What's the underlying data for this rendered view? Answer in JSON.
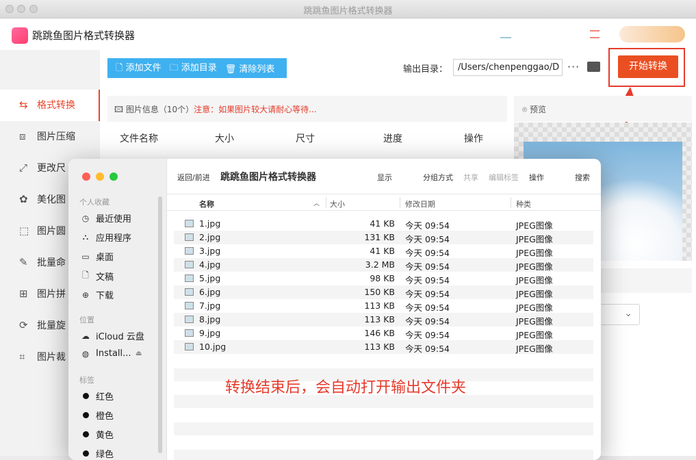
{
  "window": {
    "title": "跳跳鱼图片格式转换器"
  },
  "app": {
    "name": "跳跳鱼图片格式转换器"
  },
  "sidebar": {
    "items": [
      {
        "label": "格式转换",
        "icon": "convert-icon"
      },
      {
        "label": "图片压缩",
        "icon": "compress-icon"
      },
      {
        "label": "更改尺",
        "icon": "resize-icon"
      },
      {
        "label": "美化图",
        "icon": "beautify-icon"
      },
      {
        "label": "图片圆",
        "icon": "round-corner-icon"
      },
      {
        "label": "批量命",
        "icon": "rename-icon"
      },
      {
        "label": "图片拼",
        "icon": "stitch-icon"
      },
      {
        "label": "批量旋",
        "icon": "rotate-icon"
      },
      {
        "label": "图片裁",
        "icon": "crop-icon"
      }
    ]
  },
  "toolbar": {
    "add_file": "添加文件",
    "add_dir": "添加目录",
    "clear_list": "清除列表",
    "output_label": "输出目录：",
    "output_path": "/Users/chenpenggao/D",
    "more": "···",
    "start": "开始转换"
  },
  "info": {
    "title": "图片信息（10个）",
    "warning": "注意：如果图片较大请耐心等待..."
  },
  "table": {
    "headers": [
      "文件名称",
      "大小",
      "尺寸",
      "进度",
      "操作"
    ]
  },
  "preview": {
    "title": "预览"
  },
  "finder": {
    "nav": "返回/前进",
    "title": "跳跳鱼图片格式转换器",
    "toolbar": [
      "显示",
      "分组方式",
      "共享",
      "编辑标签",
      "操作",
      "搜索"
    ],
    "sections": {
      "favorites": "个人收藏",
      "locations": "位置",
      "tags": "标签"
    },
    "favorites": [
      {
        "label": "最近使用",
        "icon": "clock-icon"
      },
      {
        "label": "应用程序",
        "icon": "apps-icon"
      },
      {
        "label": "桌面",
        "icon": "desktop-icon"
      },
      {
        "label": "文稿",
        "icon": "document-icon"
      },
      {
        "label": "下载",
        "icon": "download-icon"
      }
    ],
    "locations": [
      {
        "label": "iCloud 云盘",
        "icon": "cloud-icon"
      },
      {
        "label": "Install...",
        "icon": "disk-icon"
      }
    ],
    "tags": [
      {
        "label": "红色"
      },
      {
        "label": "橙色"
      },
      {
        "label": "黄色"
      },
      {
        "label": "绿色"
      }
    ],
    "columns": [
      "名称",
      "大小",
      "修改日期",
      "种类"
    ],
    "files": [
      {
        "name": "1.jpg",
        "size": "41 KB",
        "date": "今天 09:54",
        "kind": "JPEG图像"
      },
      {
        "name": "2.jpg",
        "size": "131 KB",
        "date": "今天 09:54",
        "kind": "JPEG图像"
      },
      {
        "name": "3.jpg",
        "size": "41 KB",
        "date": "今天 09:54",
        "kind": "JPEG图像"
      },
      {
        "name": "4.jpg",
        "size": "3.2 MB",
        "date": "今天 09:54",
        "kind": "JPEG图像"
      },
      {
        "name": "5.jpg",
        "size": "98 KB",
        "date": "今天 09:54",
        "kind": "JPEG图像"
      },
      {
        "name": "6.jpg",
        "size": "150 KB",
        "date": "今天 09:54",
        "kind": "JPEG图像"
      },
      {
        "name": "7.jpg",
        "size": "113 KB",
        "date": "今天 09:54",
        "kind": "JPEG图像"
      },
      {
        "name": "8.jpg",
        "size": "113 KB",
        "date": "今天 09:54",
        "kind": "JPEG图像"
      },
      {
        "name": "9.jpg",
        "size": "146 KB",
        "date": "今天 09:54",
        "kind": "JPEG图像"
      },
      {
        "name": "10.jpg",
        "size": "113 KB",
        "date": "今天 09:54",
        "kind": "JPEG图像"
      }
    ]
  },
  "annotation": {
    "text": "转换结束后，会自动打开输出文件夹"
  },
  "colors": {
    "accent": "#e8452b",
    "blue": "#3fb1f0",
    "start": "#ea4f22"
  }
}
